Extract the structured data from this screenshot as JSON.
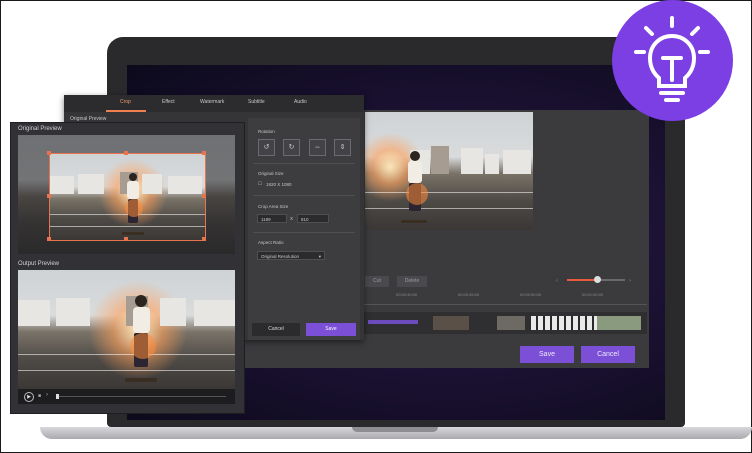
{
  "dialog": {
    "tabs": [
      "Crop",
      "Effect",
      "Watermark",
      "Subtitle",
      "Audio"
    ],
    "active_tab": "Crop",
    "subtitle": "Original Preview",
    "original_preview_label": "Original Preview",
    "output_preview_label": "Output Preview",
    "rotation_label": "Rotation",
    "original_size_label": "Original Size",
    "original_size_value": "1920 X 1080",
    "crop_area_size_label": "Crop Area Size",
    "crop_width": "1189",
    "crop_separator": "X",
    "crop_height": "810",
    "aspect_ratio_label": "Aspect Ratio",
    "aspect_ratio_value": "Original Resolution",
    "cancel_label": "Cancel",
    "save_label": "Save"
  },
  "editor": {
    "cut_label": "Cut",
    "delete_label": "Delete",
    "timestamps": [
      "00:00:40:00",
      "00:00:45:00",
      "00:00:50:00",
      "00:01:00:00"
    ],
    "save_label": "Save",
    "cancel_label": "Cancel"
  },
  "icons": {
    "badge": "lightbulb-icon",
    "rotate_left": "rotate-left-icon",
    "rotate_right": "rotate-right-icon",
    "flip_horizontal": "flip-horizontal-icon",
    "flip_vertical": "flip-vertical-icon",
    "play": "play-icon"
  },
  "colors": {
    "accent": "#7b4fd6",
    "crop_handles": "#e9734d",
    "badge": "#7b3fe4"
  }
}
